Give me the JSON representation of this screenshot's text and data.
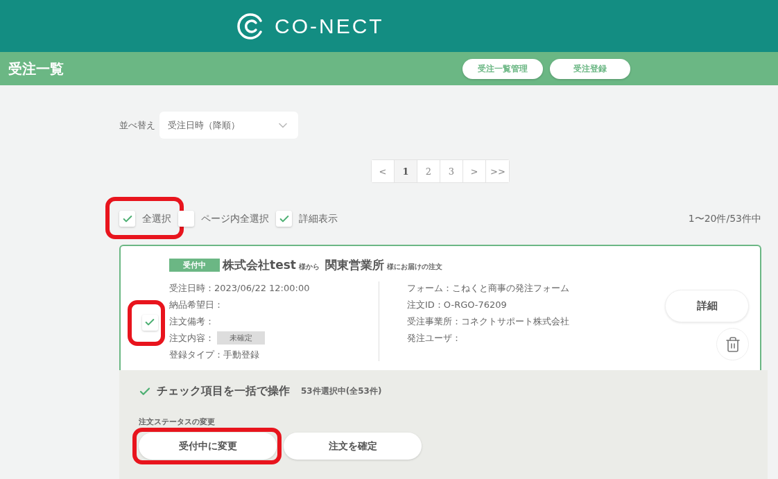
{
  "header": {
    "logo_text": "CO-NECT"
  },
  "title_bar": {
    "title": "受注一覧",
    "buttons": [
      "受注一覧管理",
      "受注登録"
    ]
  },
  "sort": {
    "label": "並べ替え",
    "value": "受注日時（降順）"
  },
  "pagination": [
    {
      "label": "<",
      "selected": false
    },
    {
      "label": "1",
      "selected": true
    },
    {
      "label": "2",
      "selected": false
    },
    {
      "label": "3",
      "selected": false
    },
    {
      "label": ">",
      "selected": false
    },
    {
      "label": ">>",
      "selected": false
    }
  ],
  "selection_options": [
    {
      "label": "全選択",
      "checked": true,
      "highlighted": true
    },
    {
      "label": "ページ内全選択",
      "checked": false,
      "highlighted": false
    },
    {
      "label": "詳細表示",
      "checked": true,
      "highlighted": false
    }
  ],
  "count": "1〜20件/53件中",
  "orders": [
    {
      "checked": true,
      "highlighted": true,
      "status": "受付中",
      "sender": "株式会社test",
      "sender_suffix": "様から",
      "recipient": "関東営業所",
      "recipient_suffix": "様にお届けの注文",
      "left_fields": [
        {
          "kind": "text",
          "text": "受注日時：2023/06/22 12:00:00"
        },
        {
          "kind": "text",
          "text": "納品希望日："
        },
        {
          "kind": "text",
          "text": "注文備考："
        },
        {
          "kind": "tag",
          "text": "注文内容：",
          "tag": "未確定"
        },
        {
          "kind": "text",
          "text": "登録タイプ：手動登録"
        }
      ],
      "right_fields": [
        {
          "kind": "text",
          "text": "フォーム：こねくと商事の発注フォーム"
        },
        {
          "kind": "text",
          "text": "注文ID：O-RGO-76209"
        },
        {
          "kind": "text",
          "text": "受注事業所：コネクトサポート株式会社"
        },
        {
          "kind": "text",
          "text": "発注ユーザ："
        }
      ],
      "detail_button": "詳細"
    }
  ],
  "bulk": {
    "title": "チェック項目を一括で操作",
    "count": "53件選択中(全53件)",
    "section_label": "注文ステータスの変更",
    "buttons": [
      {
        "label": "受付中に変更",
        "highlighted": true
      },
      {
        "label": "注文を確定",
        "highlighted": false
      }
    ]
  }
}
